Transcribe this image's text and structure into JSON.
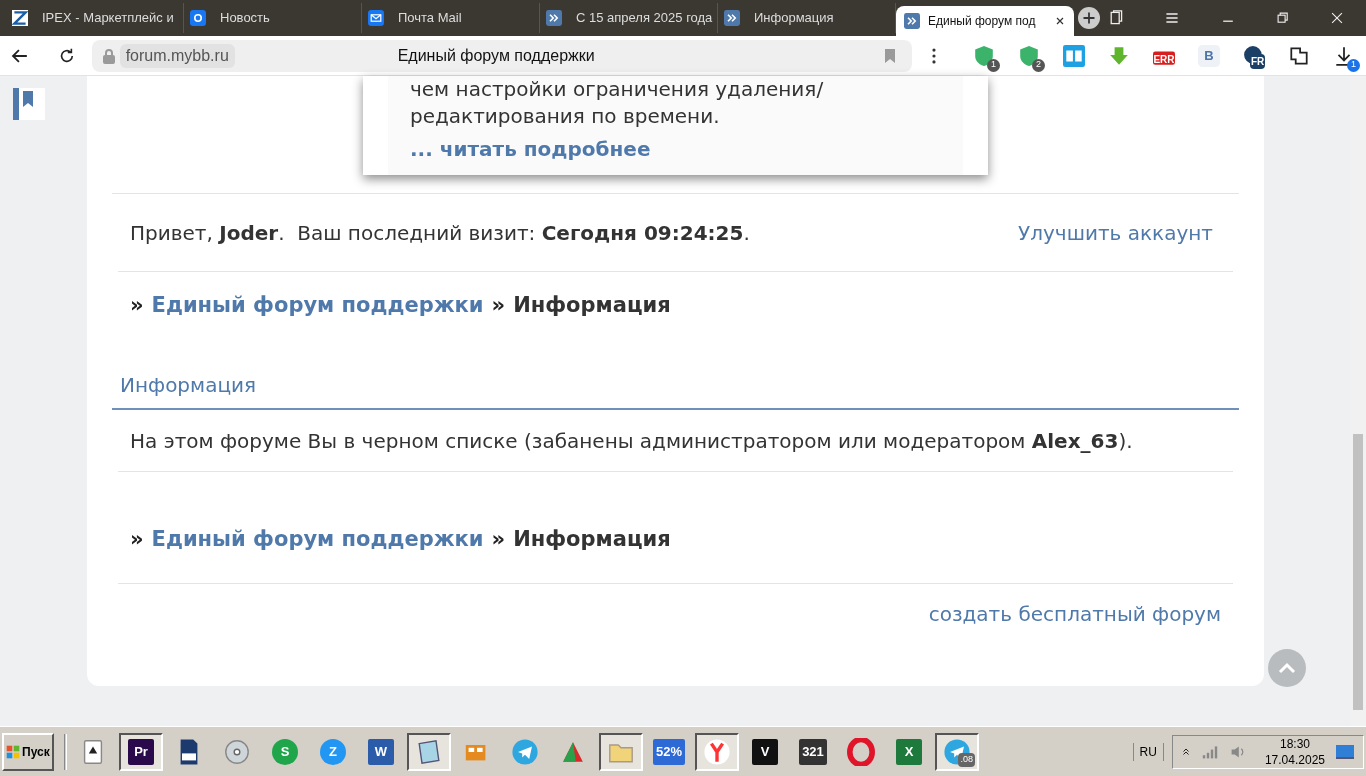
{
  "browser": {
    "tabs": [
      {
        "title": "IPEX - Маркетплейс и",
        "kind": "ipex",
        "selected": false
      },
      {
        "title": "Новость",
        "kind": "at",
        "selected": false
      },
      {
        "title": "Почта Mail",
        "kind": "mail",
        "selected": false
      },
      {
        "title": "С 15 апреля 2025 года",
        "kind": "forum",
        "selected": false
      },
      {
        "title": "Информация",
        "kind": "forum",
        "selected": false
      },
      {
        "title": "Единый форум под",
        "kind": "forum",
        "selected": true
      }
    ],
    "address": {
      "domain": "forum.mybb.ru",
      "page_title": "Единый форум поддержки"
    },
    "extensions": [
      {
        "kind": "shield",
        "badge": "1"
      },
      {
        "kind": "shield",
        "badge": "2"
      },
      {
        "kind": "book"
      },
      {
        "kind": "download"
      },
      {
        "kind": "tag",
        "label": "ERR"
      },
      {
        "kind": "letter",
        "label": "B"
      },
      {
        "kind": "globe",
        "label": "FR"
      },
      {
        "kind": "puzzle"
      },
      {
        "kind": "downloads",
        "badge": "1"
      }
    ]
  },
  "popup": {
    "lines": [
      "чем настройки ограничения удаления/",
      "редактирования по времени."
    ],
    "more_link": "... читать подробнее"
  },
  "welcome": {
    "greeting": "Привет, **Joder**.  Ваш последний визит: **Сегодня 09:24:25**.",
    "upgrade_link": "Улучшить аккаунт"
  },
  "breadcrumbs_top": {
    "separator_1": "»",
    "forum_link": "Единый форум поддержки",
    "separator_2": "»",
    "current": "Информация"
  },
  "info": {
    "heading": "Информация",
    "message": "На этом форуме Вы в черном списке (забанены администратором или модератором **Alex_63**)."
  },
  "breadcrumbs_bottom": {
    "separator_1": "»",
    "forum_link": "Единый форум поддержки",
    "separator_2": "»",
    "current": "Информация"
  },
  "footer_link": "создать бесплатный форум",
  "taskbar": {
    "start": "Пуск",
    "apps": [
      {
        "kind": "cards",
        "pressed": false
      },
      {
        "kind": "label",
        "label": "Pr",
        "color": "#2a0a4a",
        "pressed": true
      },
      {
        "kind": "sdcard",
        "pressed": false
      },
      {
        "kind": "disc",
        "pressed": false
      },
      {
        "kind": "circle",
        "label": "S",
        "color": "#1fa64a",
        "pressed": false
      },
      {
        "kind": "circle",
        "label": "Z",
        "color": "#2196f3",
        "pressed": false
      },
      {
        "kind": "label",
        "label": "W",
        "color": "#2b5caa",
        "pressed": false
      },
      {
        "kind": "notepad",
        "pressed": true
      },
      {
        "kind": "film",
        "pressed": false
      },
      {
        "kind": "telegram",
        "pressed": false
      },
      {
        "kind": "chart",
        "pressed": false
      },
      {
        "kind": "folder",
        "pressed": true
      },
      {
        "kind": "label",
        "label": "52%",
        "color": "#2d6ad6",
        "pressed": false
      },
      {
        "kind": "yandex",
        "pressed": true
      },
      {
        "kind": "label",
        "label": "V",
        "color": "#111111",
        "pressed": false
      },
      {
        "kind": "label",
        "label": "321",
        "color": "#333333",
        "pressed": false
      },
      {
        "kind": "opera",
        "pressed": false
      },
      {
        "kind": "label",
        "label": "X",
        "color": "#1e7a3c",
        "pressed": false
      },
      {
        "kind": "telegram",
        "badge": ".08",
        "pressed": true
      }
    ],
    "language": "RU",
    "time": "18:30",
    "date": "17.04.2025"
  }
}
